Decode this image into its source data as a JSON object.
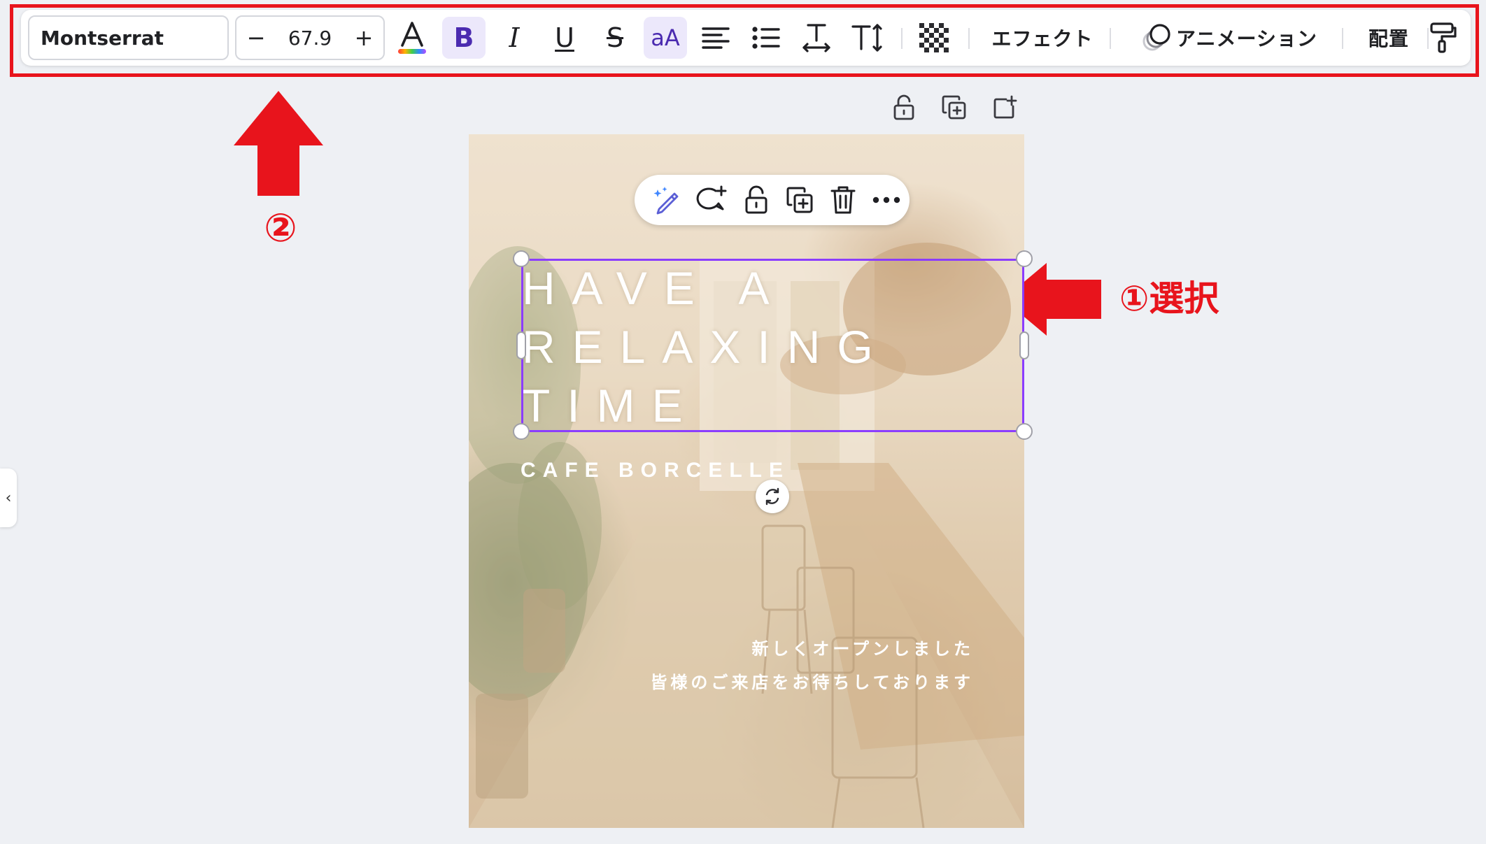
{
  "toolbar": {
    "font_name": "Montserrat",
    "font_size": "67.9",
    "decrease_label": "−",
    "increase_label": "+",
    "effects_label": "エフェクト",
    "animation_label": "アニメーション",
    "position_label": "配置",
    "case_toggle_label": "aA",
    "active_states": [
      "bold",
      "case-toggle"
    ]
  },
  "annotations": {
    "step2": "②",
    "step1": "①選択",
    "color": "#e8141c"
  },
  "design": {
    "headline_lines": [
      "HAVE A",
      "RELAXING",
      "TIME"
    ],
    "brand": "CAFE BORCELLE",
    "jp_line1": "新しくオープンしました",
    "jp_line2": "皆様のご来店をお待ちしております"
  },
  "colors": {
    "selection": "#8b3dff",
    "active_button_bg": "#ece8fb",
    "canvas_bg": "#eef0f4"
  }
}
